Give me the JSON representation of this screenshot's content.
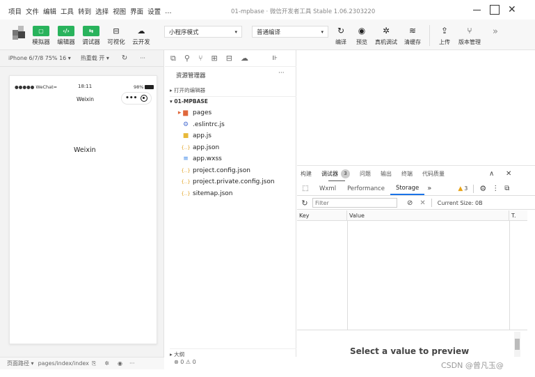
{
  "menu": [
    "项目",
    "文件",
    "编辑",
    "工具",
    "转到",
    "选择",
    "视图",
    "界面",
    "设置",
    "…"
  ],
  "window_title": "01-mpbase · 微信开发者工具 Stable 1.06.2303220",
  "toolbar_left": [
    {
      "label": "模拟器",
      "glyph": "▢"
    },
    {
      "label": "编辑器",
      "glyph": "‹/›"
    },
    {
      "label": "调试器",
      "glyph": "⇆"
    },
    {
      "label": "可视化",
      "glyph": "⊟"
    },
    {
      "label": "云开发",
      "glyph": "☁"
    }
  ],
  "mode_select": "小程序模式",
  "compile_select": "普通编译",
  "toolbar_right": [
    {
      "label": "编译",
      "glyph": "↻"
    },
    {
      "label": "预览",
      "glyph": "◉"
    },
    {
      "label": "真机调试",
      "glyph": "✲"
    },
    {
      "label": "清缓存",
      "glyph": "≋"
    },
    {
      "label": "上传",
      "glyph": "⇪"
    },
    {
      "label": "版本管理",
      "glyph": "⑂"
    }
  ],
  "expand_glyph": "»",
  "sim_bar": {
    "device": "iPhone 6/7/8 75% 16 ▾",
    "hot_reload": "热重载 开 ▾",
    "refresh": "↻",
    "more": "···"
  },
  "phone": {
    "carrier": "●●●●● WeChat",
    "wifi": "≈",
    "time": "18:11",
    "battery": "98%",
    "nav_title": "Weixin",
    "capsule_dots": "•••",
    "page_text": "Weixin"
  },
  "explorer": {
    "title": "资源管理器",
    "more": "···",
    "open_editors": "▸ 打开的编辑器",
    "project": "▾ 01-MPBASE",
    "files": [
      {
        "name": "pages",
        "icon": "▸ ▆",
        "color": "#e0683c"
      },
      {
        "name": ".eslintrc.js",
        "icon": "⚙",
        "color": "#4a6fd1"
      },
      {
        "name": "app.js",
        "icon": "■",
        "color": "#e8b93a"
      },
      {
        "name": "app.json",
        "icon": "{..}",
        "color": "#e3a52b"
      },
      {
        "name": "app.wxss",
        "icon": "≡",
        "color": "#2a7be4"
      },
      {
        "name": "project.config.json",
        "icon": "{..}",
        "color": "#e3a52b"
      },
      {
        "name": "project.private.config.json",
        "icon": "{..}",
        "color": "#e3a52b"
      },
      {
        "name": "sitemap.json",
        "icon": "{..}",
        "color": "#e3a52b"
      }
    ],
    "outline": "▸ 大纲"
  },
  "debug": {
    "top_tabs": [
      "构建",
      "调试器",
      "问题",
      "输出",
      "终端",
      "代码质量"
    ],
    "badge": "3",
    "collapse": "∧",
    "close": "✕",
    "sub_tabs": [
      "Wxml",
      "Performance",
      "Storage"
    ],
    "sub_more": "»",
    "warn_count": "3",
    "filter_placeholder": "Filter",
    "current_size": "Current Size: 0B",
    "col_key": "Key",
    "col_value": "Value",
    "col_t": "T.",
    "preview": "Select a value to preview"
  },
  "status": {
    "path_label": "页面路径 ▾",
    "path": "pages/index/index",
    "errors": "⊗ 0 ⚠ 0"
  },
  "watermark": "CSDN @曾凡玉@"
}
